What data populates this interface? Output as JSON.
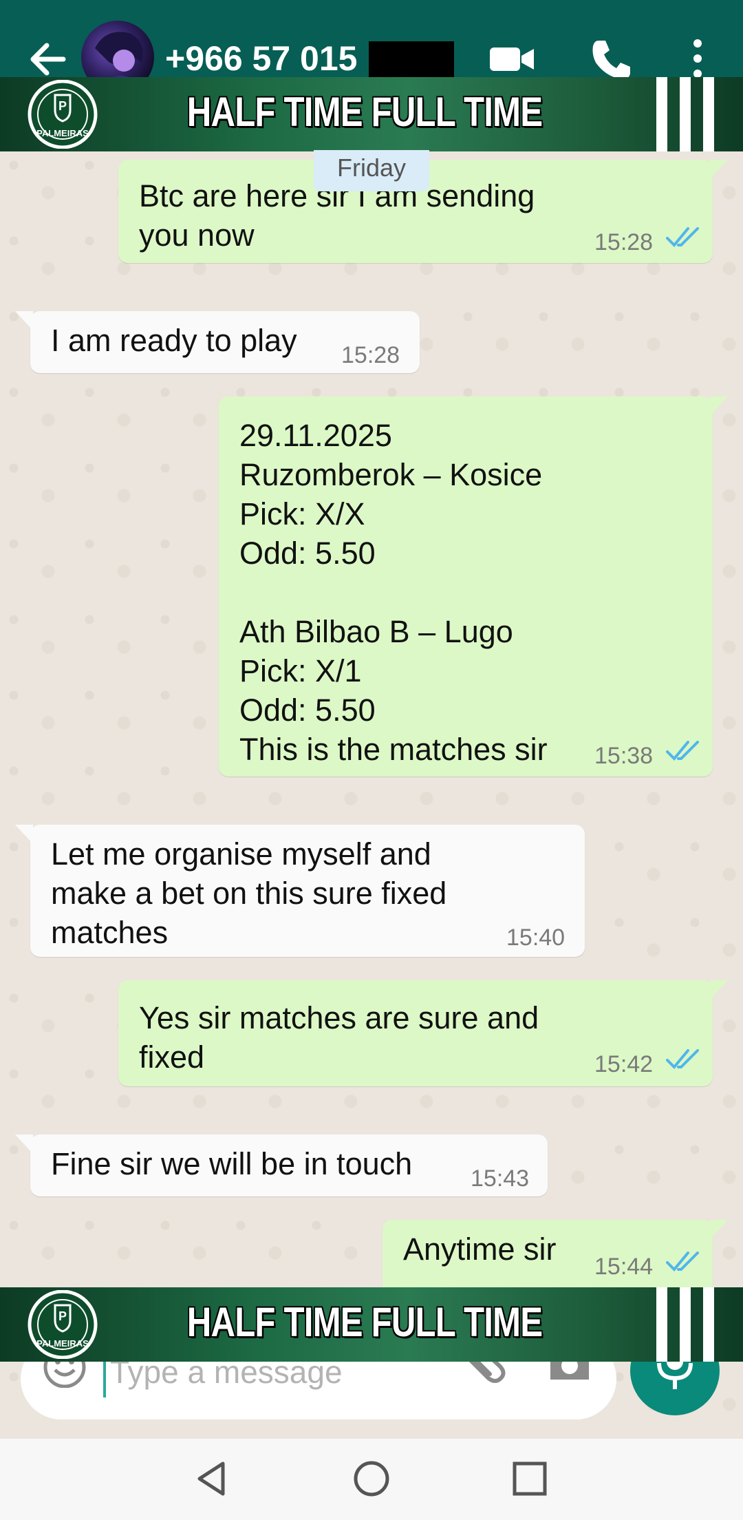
{
  "header": {
    "contact_name": "+966 57 015",
    "icons": [
      "back-arrow-icon",
      "video-call-icon",
      "phone-icon",
      "more-vert-icon"
    ]
  },
  "banner": {
    "title": "HALF TIME FULL TIME",
    "crest_text": "PALMEIRAS"
  },
  "date_chip": "Friday",
  "messages": [
    {
      "direction": "out",
      "text": "Btc are here sir I am sending\nyou now",
      "time": "15:28",
      "status": "read"
    },
    {
      "direction": "in",
      "text": "I am ready to play",
      "time": "15:28"
    },
    {
      "direction": "out",
      "text": "29.11.2025\nRuzomberok – Kosice\nPick: X/X\nOdd: 5.50\n\nAth Bilbao B – Lugo\nPick: X/1\nOdd: 5.50\nThis is the matches sir",
      "time": "15:38",
      "status": "read"
    },
    {
      "direction": "in",
      "text": "Let me organise myself and\nmake a bet on this sure fixed\nmatches",
      "time": "15:40"
    },
    {
      "direction": "out",
      "text": "Yes sir matches are sure and\nfixed",
      "time": "15:42",
      "status": "read"
    },
    {
      "direction": "in",
      "text": "Fine sir we will be in touch",
      "time": "15:43"
    },
    {
      "direction": "out",
      "text": "Anytime sir",
      "time": "15:44",
      "status": "read"
    }
  ],
  "composer": {
    "placeholder": "Type a message",
    "icons": [
      "emoji-icon",
      "attach-icon",
      "camera-icon",
      "mic-icon"
    ]
  },
  "colors": {
    "header": "#075e54",
    "outgoing_bubble": "#dcf8c6",
    "incoming_bubble": "#fafafa",
    "read_ticks": "#4fb6ec",
    "mic_button": "#0a8a7a"
  }
}
